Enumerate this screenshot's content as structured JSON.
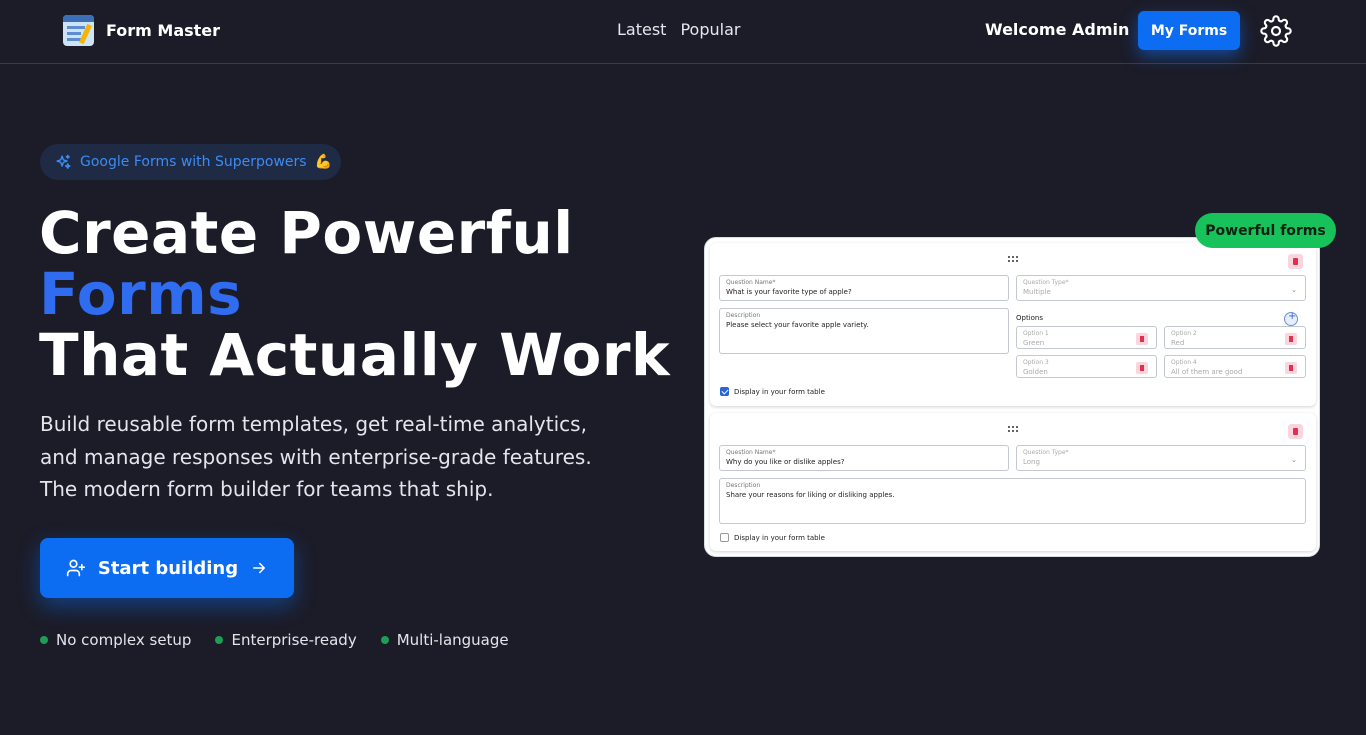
{
  "nav": {
    "brand": "Form Master",
    "links": [
      "Latest",
      "Popular"
    ],
    "welcome": "Welcome Admin",
    "my_forms_label": "My Forms",
    "settings_icon": "gear-icon"
  },
  "hero": {
    "pill_text": "Google Forms with Superpowers",
    "pill_emoji": "💪",
    "pill_icon": "sparkles-icon",
    "headline_line1": "Create Powerful",
    "headline_line2": "Forms",
    "headline_line3": "That Actually Work",
    "subtitle_line1": "Build reusable form templates, get real-time analytics,",
    "subtitle_line2": "and manage responses with enterprise-grade features.",
    "subtitle_line3": "The modern form builder for teams that ship.",
    "cta_label": "Start building",
    "cta_icon": "user-plus-icon",
    "features": [
      "No complex setup",
      "Enterprise-ready",
      "Multi-language"
    ]
  },
  "preview": {
    "badge": "Powerful forms",
    "card1": {
      "question_label": "Question Name*",
      "question_value": "What is your favorite type of apple?",
      "type_label": "Question Type*",
      "type_value": "Multiple",
      "description_label": "Description",
      "description_value": "Please select your favorite apple variety.",
      "options_title": "Options",
      "options": [
        {
          "label": "Option 1",
          "value": "Green"
        },
        {
          "label": "Option 2",
          "value": "Red"
        },
        {
          "label": "Option 3",
          "value": "Golden"
        },
        {
          "label": "Option 4",
          "value": "All of them are good"
        }
      ],
      "display_label": "Display in your form table",
      "display_checked": true
    },
    "card2": {
      "question_label": "Question Name*",
      "question_value": "Why do you like or dislike apples?",
      "type_label": "Question Type*",
      "type_value": "Long",
      "description_label": "Description",
      "description_value": "Share your reasons for liking or disliking apples.",
      "display_label": "Display in your form table",
      "display_checked": false
    }
  },
  "colors": {
    "background": "#1c1c28",
    "accent": "#0c6cf2",
    "headline_blue": "#2f6cf0",
    "badge_green": "#18c25a",
    "feature_dot": "#1f9d55"
  }
}
